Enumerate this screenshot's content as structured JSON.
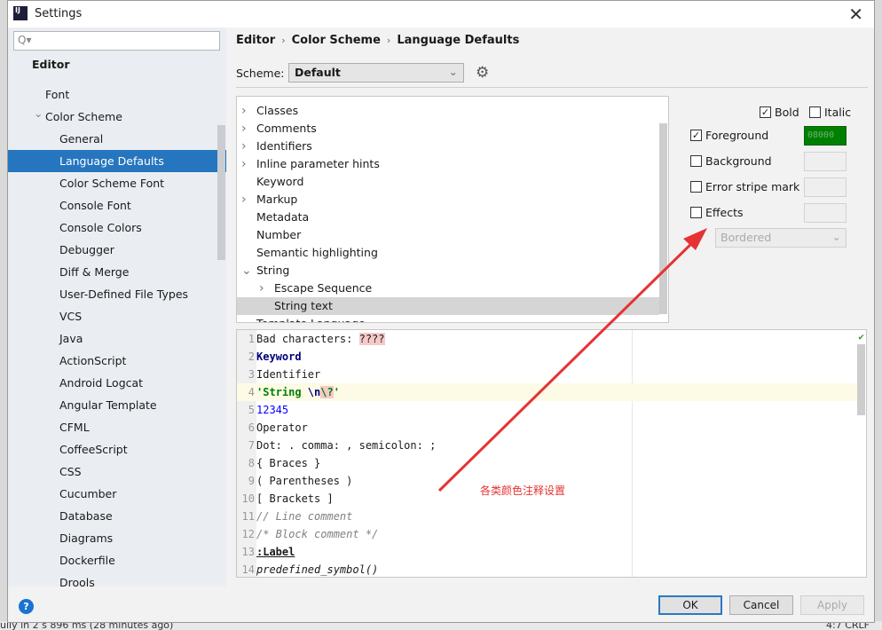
{
  "window": {
    "title": "Settings",
    "close": "✕"
  },
  "search": {
    "placeholder": "Q▾"
  },
  "sidebar": {
    "header": "Editor",
    "items": [
      {
        "label": "Font",
        "indent": 1
      },
      {
        "label": "Color Scheme",
        "indent": 1,
        "expanded": true
      },
      {
        "label": "General",
        "indent": 2
      },
      {
        "label": "Language Defaults",
        "indent": 2,
        "selected": true
      },
      {
        "label": "Color Scheme Font",
        "indent": 2
      },
      {
        "label": "Console Font",
        "indent": 2
      },
      {
        "label": "Console Colors",
        "indent": 2
      },
      {
        "label": "Debugger",
        "indent": 2
      },
      {
        "label": "Diff & Merge",
        "indent": 2
      },
      {
        "label": "User-Defined File Types",
        "indent": 2
      },
      {
        "label": "VCS",
        "indent": 2
      },
      {
        "label": "Java",
        "indent": 2
      },
      {
        "label": "ActionScript",
        "indent": 2
      },
      {
        "label": "Android Logcat",
        "indent": 2
      },
      {
        "label": "Angular Template",
        "indent": 2
      },
      {
        "label": "CFML",
        "indent": 2
      },
      {
        "label": "CoffeeScript",
        "indent": 2
      },
      {
        "label": "CSS",
        "indent": 2
      },
      {
        "label": "Cucumber",
        "indent": 2
      },
      {
        "label": "Database",
        "indent": 2
      },
      {
        "label": "Diagrams",
        "indent": 2
      },
      {
        "label": "Dockerfile",
        "indent": 2
      },
      {
        "label": "Drools",
        "indent": 2
      }
    ]
  },
  "breadcrumb": [
    "Editor",
    "Color Scheme",
    "Language Defaults"
  ],
  "scheme": {
    "label": "Scheme:",
    "value": "Default"
  },
  "tree": [
    {
      "label": "Classes",
      "arrow": "right",
      "level": 0
    },
    {
      "label": "Comments",
      "arrow": "right",
      "level": 0
    },
    {
      "label": "Identifiers",
      "arrow": "right",
      "level": 0
    },
    {
      "label": "Inline parameter hints",
      "arrow": "right",
      "level": 0
    },
    {
      "label": "Keyword",
      "level": 0
    },
    {
      "label": "Markup",
      "arrow": "right",
      "level": 0
    },
    {
      "label": "Metadata",
      "level": 0
    },
    {
      "label": "Number",
      "level": 0
    },
    {
      "label": "Semantic highlighting",
      "level": 0
    },
    {
      "label": "String",
      "arrow": "down",
      "level": 0
    },
    {
      "label": "Escape Sequence",
      "arrow": "right",
      "level": 1
    },
    {
      "label": "String text",
      "level": 1,
      "selected": true
    },
    {
      "label": "Template Language",
      "level": 0
    }
  ],
  "options": {
    "bold": {
      "label": "Bold",
      "checked": true
    },
    "italic": {
      "label": "Italic",
      "checked": false
    },
    "foreground": {
      "label": "Foreground",
      "checked": true,
      "value": "08000",
      "color": "#008000"
    },
    "background": {
      "label": "Background",
      "checked": false
    },
    "error_stripe": {
      "label": "Error stripe mark",
      "checked": false
    },
    "effects": {
      "label": "Effects",
      "checked": false
    },
    "effect_type": "Bordered"
  },
  "preview": {
    "lines": [
      {
        "n": "1",
        "html": "Bad characters: <span class='bad'>????</span>"
      },
      {
        "n": "2",
        "html": "<span class='kw'>Keyword</span>"
      },
      {
        "n": "3",
        "html": "Identifier"
      },
      {
        "n": "4",
        "html": "<span class='str'>'String </span><span class='esc'>\\n</span><span class='bad str'>\\?</span><span class='str'>'</span>",
        "current": true
      },
      {
        "n": "5",
        "html": "<span class='num5'>12345</span>"
      },
      {
        "n": "6",
        "html": "Operator"
      },
      {
        "n": "7",
        "html": "Dot: . comma: , semicolon: ;"
      },
      {
        "n": "8",
        "html": "{ Braces }"
      },
      {
        "n": "9",
        "html": "( Parentheses )"
      },
      {
        "n": "10",
        "html": "[ Brackets ]"
      },
      {
        "n": "11",
        "html": "<span class='cm'>// Line comment</span>"
      },
      {
        "n": "12",
        "html": "<span class='cm'>/* Block comment */</span>"
      },
      {
        "n": "13",
        "html": "<span class='lbl'>:Label</span>"
      },
      {
        "n": "14",
        "html": "<span class='ps'>predefined_symbol()</span>"
      }
    ]
  },
  "buttons": {
    "ok": "OK",
    "cancel": "Cancel",
    "apply": "Apply",
    "help": "?"
  },
  "annotation": {
    "text": "各类颜色注释设置",
    "color": "#e53333"
  },
  "background_status": {
    "left": "ully in 2 s 896 ms (28 minutes ago)",
    "right": "4:7  CRLF"
  }
}
